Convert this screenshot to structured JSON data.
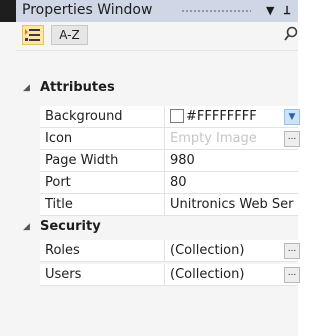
{
  "window": {
    "title": "Properties Window"
  },
  "toolbar": {
    "az_label": "A-Z"
  },
  "categories": {
    "attributes": "Attributes",
    "security": "Security"
  },
  "properties": {
    "background": {
      "name": "Background",
      "value": "#FFFFFFFF"
    },
    "icon": {
      "name": "Icon",
      "value": "Empty Image"
    },
    "page_width": {
      "name": "Page Width",
      "value": "980"
    },
    "port": {
      "name": "Port",
      "value": "80"
    },
    "title": {
      "name": "Title",
      "value": "Unitronics Web Ser"
    },
    "roles": {
      "name": "Roles",
      "value": "(Collection)"
    },
    "users": {
      "name": "Users",
      "value": "(Collection)"
    }
  },
  "glyphs": {
    "pin": "▾  ⊓",
    "search": "⚲",
    "collapse": "◢",
    "dropdown": "▼",
    "ellipsis": "..."
  },
  "colors": {
    "titlebar": "#cfd6e5",
    "selected_tool": "#ffe6a8",
    "dropdown_button": "#cfe3f8"
  }
}
